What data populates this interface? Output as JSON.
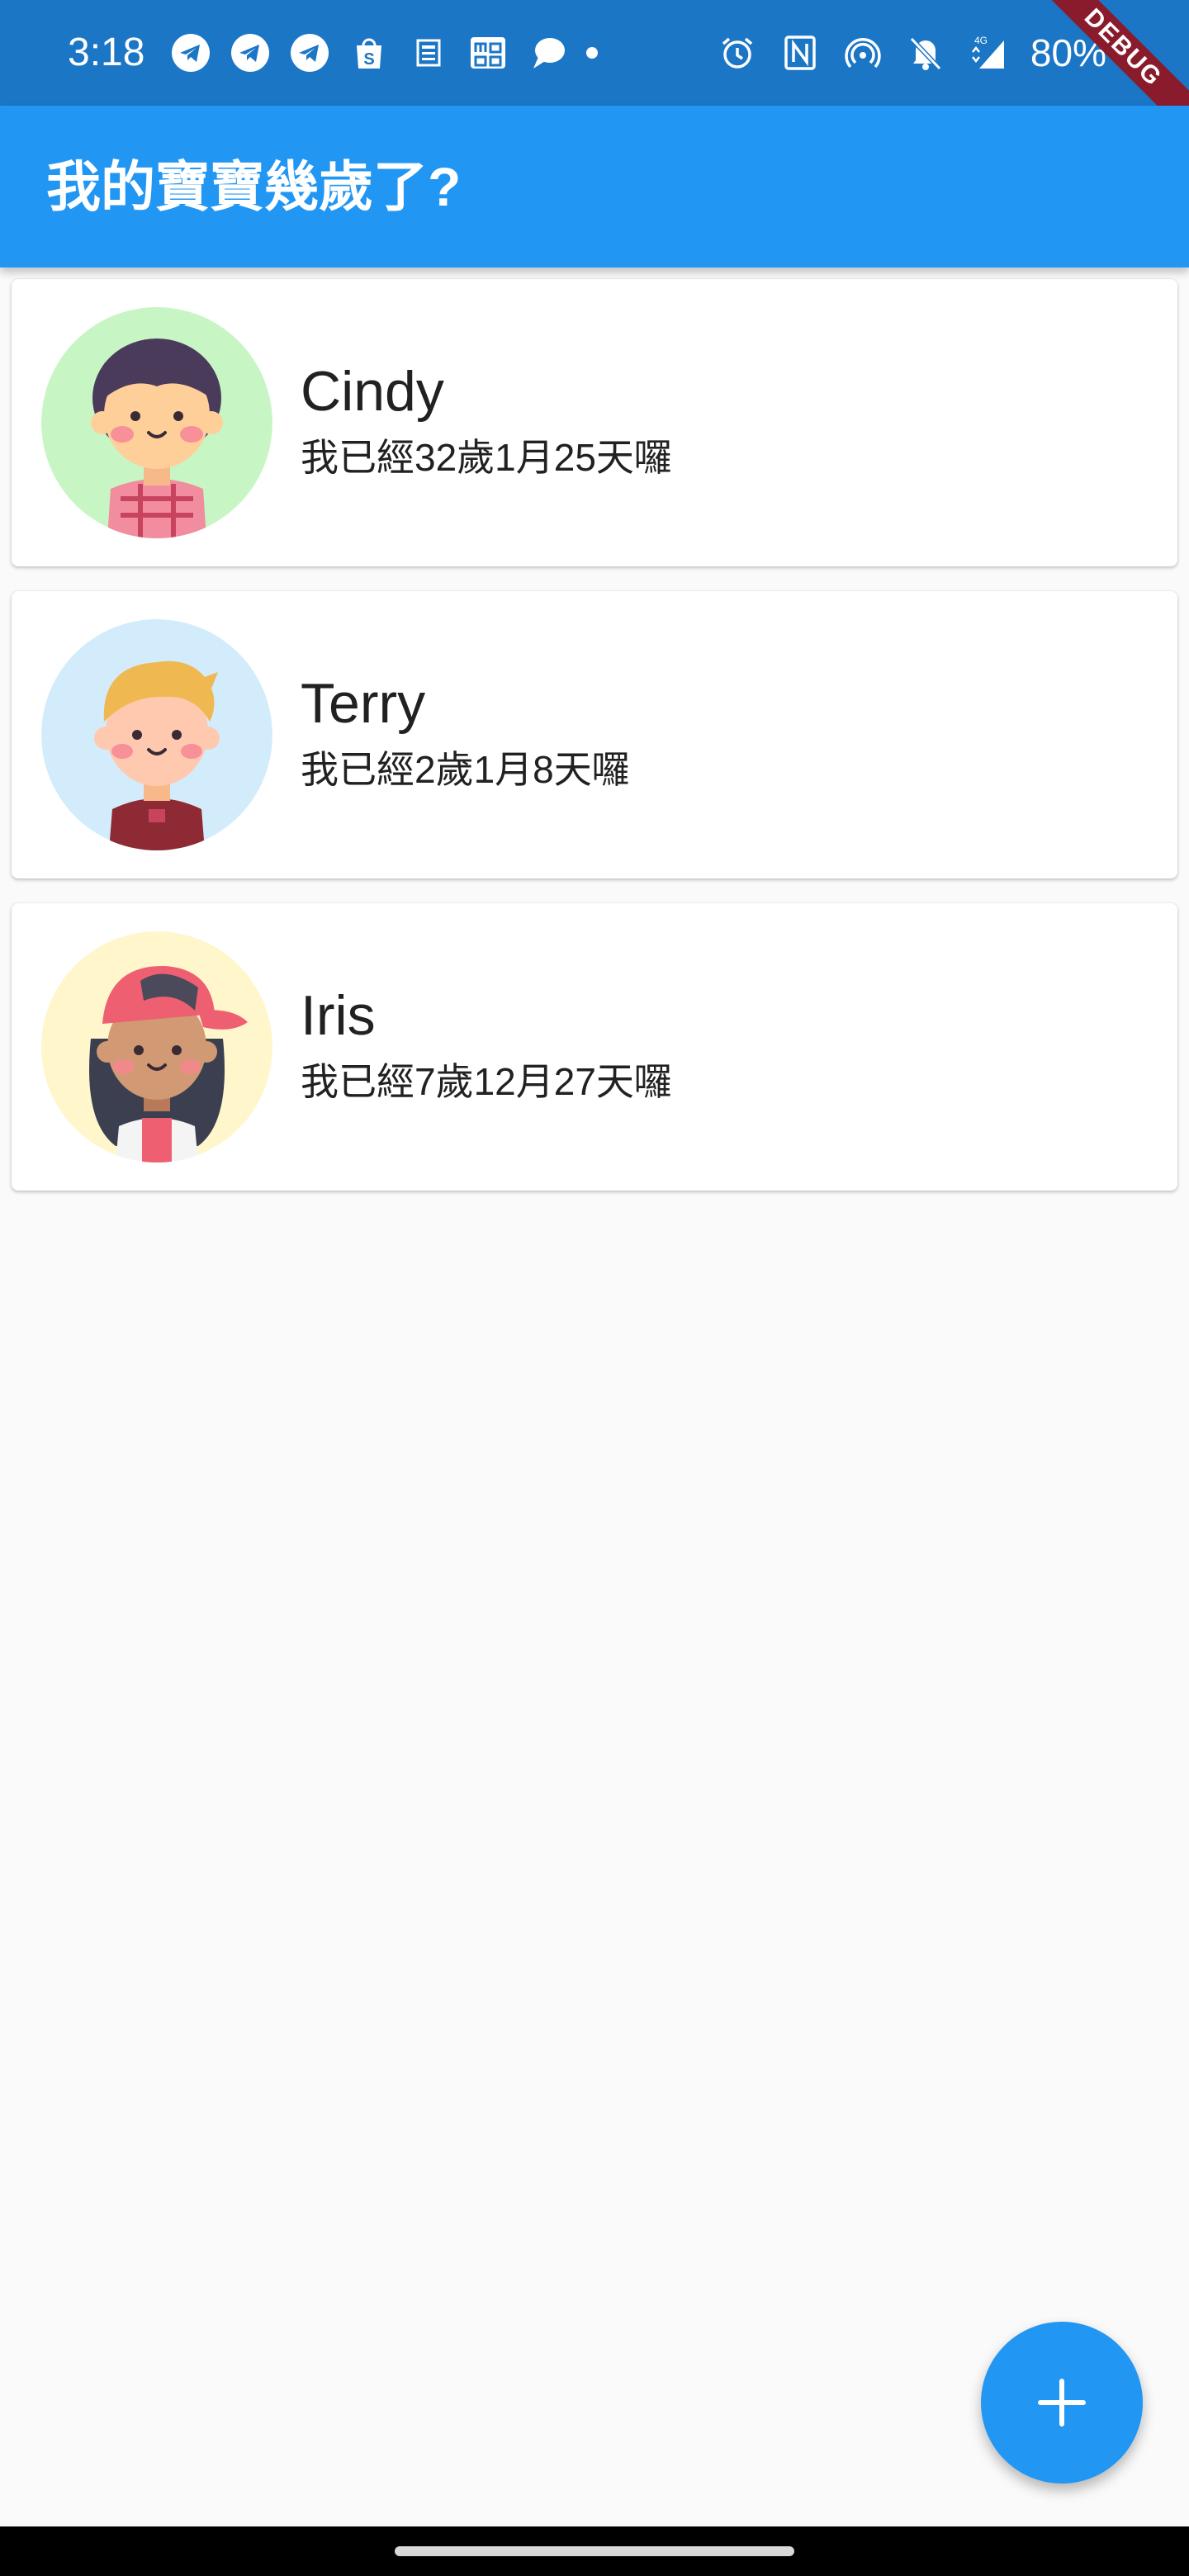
{
  "status_bar": {
    "time": "3:18",
    "battery": "80%",
    "notification_icons": [
      "telegram-icon",
      "telegram-icon",
      "telegram-icon",
      "shopee-icon",
      "news-icon",
      "momo-icon",
      "chat-bubble-icon"
    ],
    "system_icons": [
      "alarm-icon",
      "nfc-icon",
      "hotspot-icon",
      "mute-icon",
      "signal-4g-icon"
    ]
  },
  "debug_banner": {
    "label": "DEBUG"
  },
  "app_bar": {
    "title": "我的寶寶幾歲了?"
  },
  "children": [
    {
      "name": "Cindy",
      "age_text": "我已經32歲1月25天囉",
      "avatar_bg": "#c8f5c4",
      "avatar": "girl-avatar-icon"
    },
    {
      "name": "Terry",
      "age_text": "我已經2歲1月8天囉",
      "avatar_bg": "#d3ecfb",
      "avatar": "boy-avatar-icon"
    },
    {
      "name": "Iris",
      "age_text": "我已經7歲12月27天囉",
      "avatar_bg": "#fff6cc",
      "avatar": "girl-cap-avatar-icon"
    }
  ],
  "fab": {
    "icon": "plus-icon",
    "color": "#2196f3"
  },
  "colors": {
    "primary": "#2196f3",
    "status_bar": "#1b76c6",
    "background": "#fafafa"
  }
}
